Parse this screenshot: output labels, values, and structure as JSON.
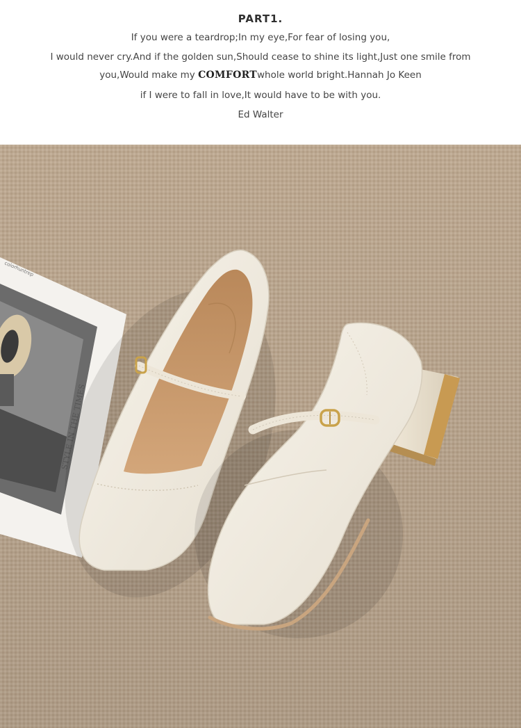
{
  "header": {
    "part_title": "PART1.",
    "line1": "If you were a teardrop;In my eye,For fear of losing you,",
    "line2": "I would never cry.And if the golden sun,Should cease to shine its light,Just one smile from",
    "line3_before": "you,Would make my ",
    "line3_emphasis": "COMFORT",
    "line3_after": "whole world bright.Hannah Jo Keen",
    "line4": "if I were to fall in love,It would have to be with you.",
    "line5": "Ed Walter"
  },
  "photo": {
    "magazine_spine_text": "colorhuntrep",
    "magazine_side_text": "STYLE IN THE TIMES",
    "colors": {
      "carpet": "#bda992",
      "shoe_leather": "#f1ece1",
      "insole": "#c8986a",
      "buckle_gold": "#c9a24a",
      "heel_gold": "#c89a52"
    }
  }
}
